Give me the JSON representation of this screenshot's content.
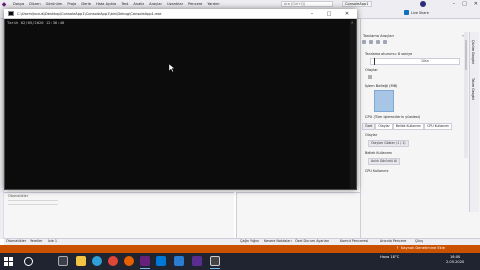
{
  "vs": {
    "menu": [
      "Dosya",
      "Düzen",
      "Görünüm",
      "Proje",
      "Derle",
      "Hata Ayıkla",
      "Test",
      "Analiz",
      "Araçlar",
      "Uzantılar",
      "Pencere",
      "Yardım"
    ],
    "search_placeholder": "Ara (Ctrl+Q)",
    "solution_name": "ConsoleApp1",
    "toolbar": {
      "config": "Debug",
      "platform": "Any CPU",
      "continue_label": "Devam"
    },
    "live_share": "Live Share",
    "diagnostic": {
      "title": "Tanılama Araçları",
      "session_label": "Tanılama oturumu: 8 saniye",
      "timeline_label": "10sn",
      "events_label": "Olaylar",
      "memory_label": "İşlem Belleği (MB)",
      "cpu_label": "CPU (Tüm işlemcilerin yüzdesi)",
      "tabs": [
        "Özet",
        "Olaylar",
        "Bellek Kullanımı",
        "CPU Kullanımı"
      ],
      "section_events": "Olaylar",
      "btn_events": "Olayları Göster (1 / 1)",
      "section_memory": "Bellek Kullanımı",
      "btn_snapshot": "Anlık Görüntü Al",
      "section_cpu": "CPU Kullanımı"
    },
    "side_tabs": [
      "Çözüm Gezgini",
      "Takım Gezgini"
    ],
    "bottom_left_header": "Otomatikler",
    "bottom_tabs_left": [
      "Otomatikler",
      "Yereller",
      "İzle 1"
    ],
    "bottom_tabs_right": [
      "Çağrı Yığını",
      "Kesme Noktaları",
      "Özel Durum Ayarları",
      "Komut Penceresi",
      "Anında Pencere",
      "Çıkış"
    ],
    "status_text": "Kaynak Denetimine Ekle"
  },
  "console": {
    "title": "C:\\Users\\kucuk\\Desktop\\ConsoleApp1\\ConsoleApp1\\bin\\Debug\\ConsoleApp1.exe",
    "output": "Tarih 02/05/2020 12:36:40"
  },
  "taskbar": {
    "tray_text": "Hava 18°C",
    "time": "16:00",
    "date": "2.05.2020"
  },
  "icons": {
    "start": "windows-start-icon",
    "search": "search-icon"
  },
  "colors": {
    "status_bar": "#ca5100",
    "console_bg": "#0c0c0c",
    "taskbar": "#1f2430"
  }
}
